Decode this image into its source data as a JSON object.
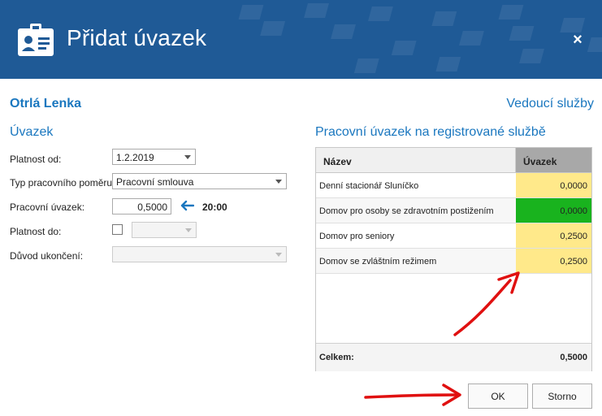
{
  "header": {
    "title": "Přidat úvazek",
    "close_label": "×"
  },
  "person": {
    "name": "Otrlá Lenka"
  },
  "lead_link": "Vedoucí služby",
  "left_section": {
    "title": "Úvazek",
    "fields": {
      "platnost_od": {
        "label": "Platnost od:",
        "value": "1.2.2019"
      },
      "typ_pomeru": {
        "label": "Typ pracovního poměru:",
        "value": "Pracovní smlouva"
      },
      "pracovni_uvazek": {
        "label": "Pracovní úvazek:",
        "value": "0,5000",
        "time": "20:00"
      },
      "platnost_do": {
        "label": "Platnost do:",
        "value": ""
      },
      "duvod_ukonceni": {
        "label": "Důvod ukončení:",
        "value": ""
      }
    }
  },
  "right_section": {
    "title": "Pracovní úvazek na registrované službě",
    "columns": [
      "Název",
      "Úvazek"
    ],
    "rows": [
      {
        "name": "Denní stacionář Sluníčko",
        "value": "0,0000",
        "color": "#ffe98a"
      },
      {
        "name": "Domov pro osoby se zdravotním postižením",
        "value": "0,0000",
        "color": "#19b31e"
      },
      {
        "name": "Domov pro seniory",
        "value": "0,2500",
        "color": "#ffe98a"
      },
      {
        "name": "Domov se zvláštním režimem",
        "value": "0,2500",
        "color": "#ffe98a"
      }
    ],
    "total_label": "Celkem:",
    "total_value": "0,5000"
  },
  "buttons": {
    "ok": "OK",
    "storno": "Storno"
  },
  "colors": {
    "header": "#1f5a96",
    "accent": "#1a77bf",
    "annotation_arrow": "#e01010"
  }
}
